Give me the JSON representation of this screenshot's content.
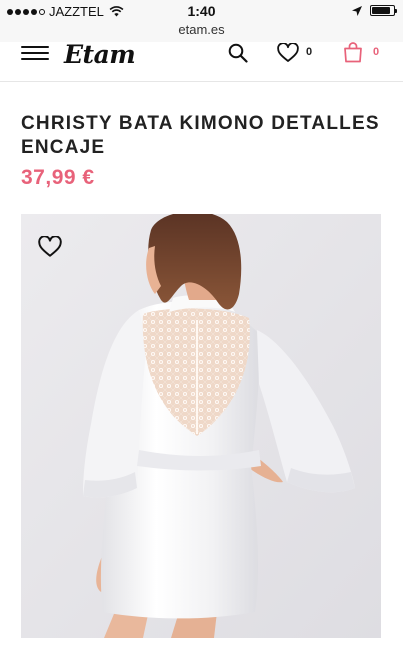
{
  "status_bar": {
    "carrier": "JAZZTEL",
    "time": "1:40",
    "battery_level": 0.85
  },
  "browser": {
    "url": "etam.es"
  },
  "header": {
    "logo": "Etam",
    "wishlist_count": "0",
    "cart_count": "0",
    "icons": [
      "menu-icon",
      "search-icon",
      "heart-icon",
      "shopping-bag-icon"
    ],
    "accent_color": "#e8627a"
  },
  "product": {
    "title": "CHRISTY BATA KIMONO DETALLES ENCAJE",
    "price": "37,99 €",
    "price_color": "#e8627a"
  }
}
